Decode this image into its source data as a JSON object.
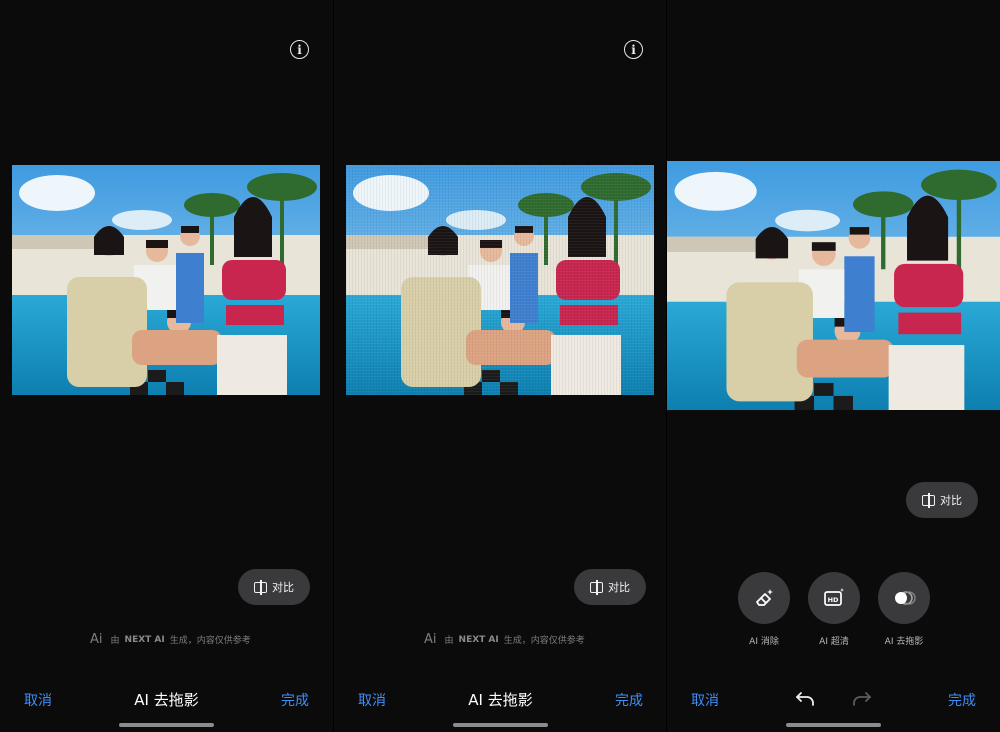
{
  "panels": [
    {
      "compare_label": "对比",
      "disclaimer": {
        "logo": "Ai",
        "prefix": "由",
        "brand": "NEXT AI",
        "suffix": "生成，内容仅供参考"
      },
      "bottom": {
        "cancel": "取消",
        "title": "AI 去拖影",
        "done": "完成"
      }
    },
    {
      "compare_label": "对比",
      "disclaimer": {
        "logo": "Ai",
        "prefix": "由",
        "brand": "NEXT AI",
        "suffix": "生成，内容仅供参考"
      },
      "bottom": {
        "cancel": "取消",
        "title": "AI 去拖影",
        "done": "完成"
      }
    },
    {
      "compare_label": "对比",
      "tools": [
        {
          "label": "AI 消除",
          "icon": "eraser-sparkle-icon"
        },
        {
          "label": "AI 超清",
          "icon": "hd-sparkle-icon"
        },
        {
          "label": "AI 去拖影",
          "icon": "deblur-circle-icon"
        }
      ],
      "bottom": {
        "cancel": "取消",
        "done": "完成"
      }
    }
  ],
  "colors": {
    "accent": "#3e8ef7",
    "background": "#0b0b0c",
    "pill": "#3a3a3d"
  }
}
